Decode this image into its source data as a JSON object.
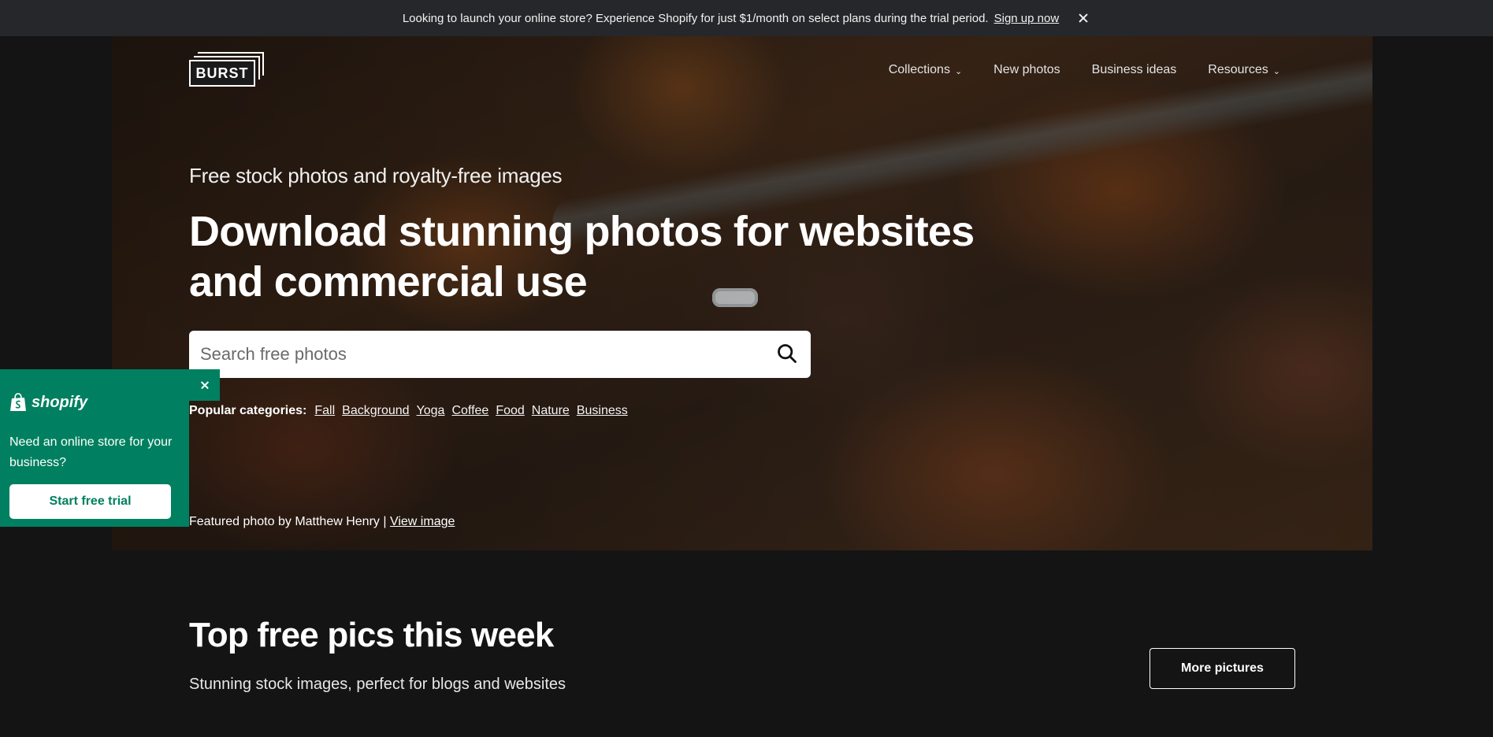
{
  "announcement": {
    "text": "Looking to launch your online store? Experience Shopify for just $1/month on select plans during the trial period.",
    "link_label": "Sign up now"
  },
  "logo": {
    "text": "BURST"
  },
  "nav": {
    "items": [
      {
        "label": "Collections",
        "has_dropdown": true
      },
      {
        "label": "New photos",
        "has_dropdown": false
      },
      {
        "label": "Business ideas",
        "has_dropdown": false
      },
      {
        "label": "Resources",
        "has_dropdown": true
      }
    ]
  },
  "hero": {
    "subtitle": "Free stock photos and royalty-free images",
    "headline": "Download stunning photos for websites and commercial use",
    "search_placeholder": "Search free photos",
    "popular_label": "Popular categories:",
    "categories": [
      "Fall",
      "Background",
      "Yoga",
      "Coffee",
      "Food",
      "Nature",
      "Business"
    ],
    "credit_text": "Featured photo by Matthew Henry |",
    "credit_link": "View image"
  },
  "shopify_popup": {
    "brand": "shopify",
    "message": "Need an online store for your business?",
    "button_label": "Start free trial",
    "accent_color": "#008060"
  },
  "section": {
    "title": "Top free pics this week",
    "subtitle": "Stunning stock images, perfect for blogs and websites",
    "button_label": "More pictures"
  }
}
